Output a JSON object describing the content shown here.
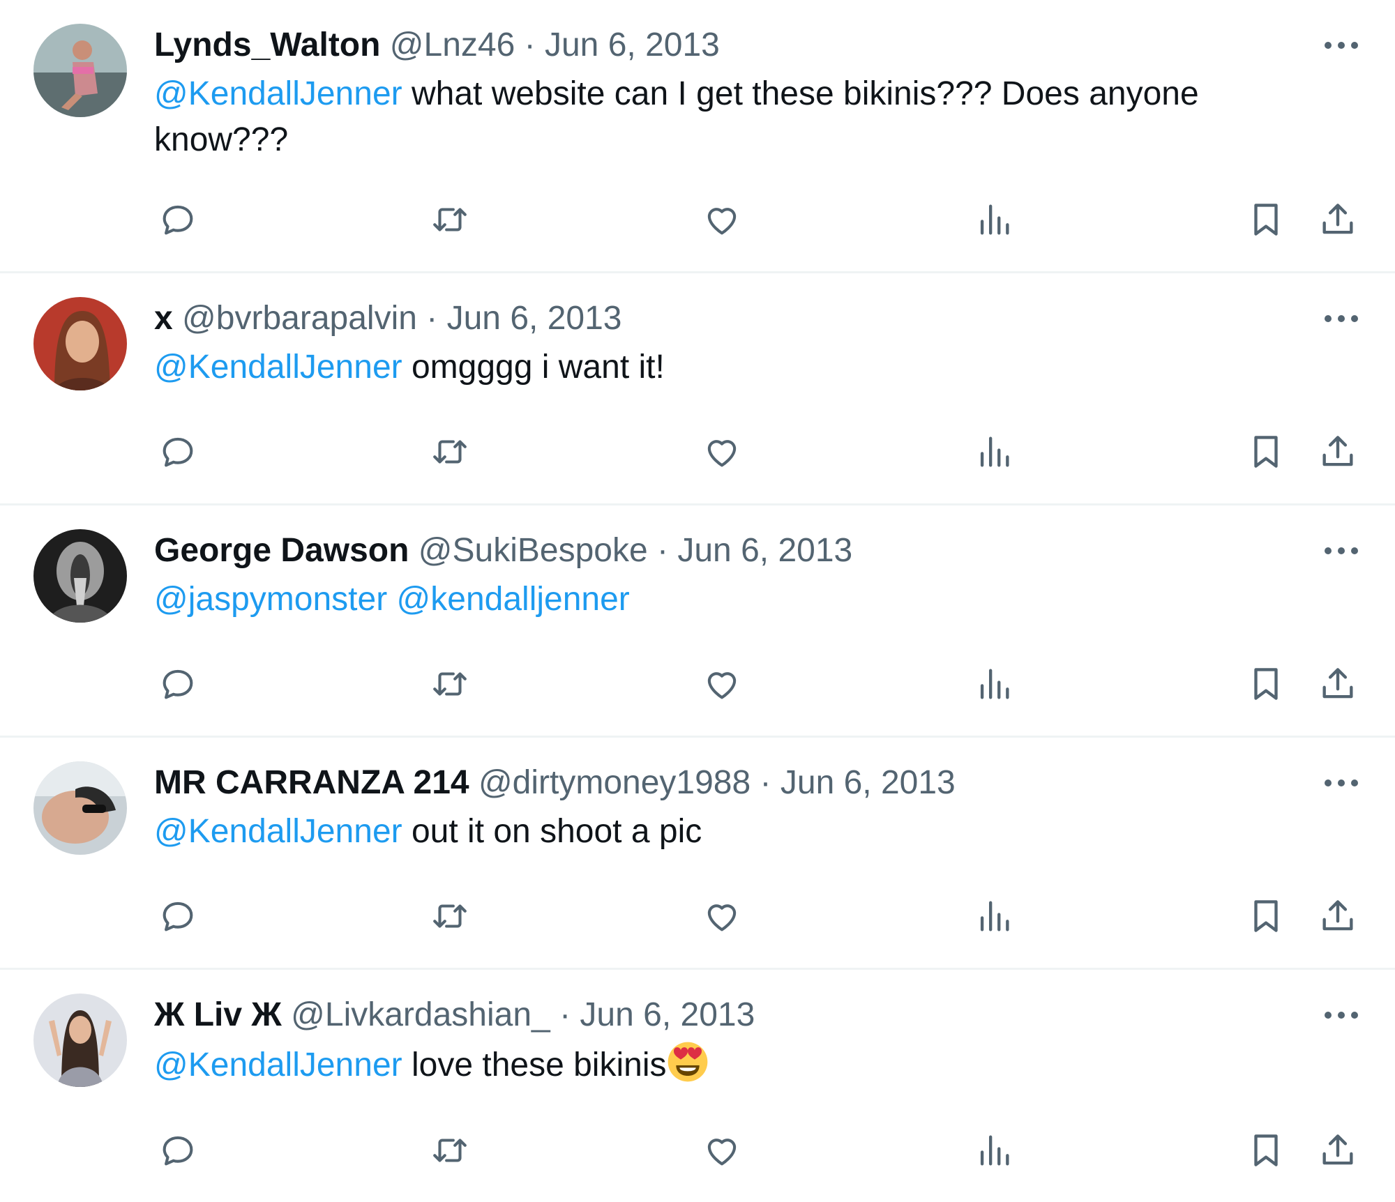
{
  "tweets": [
    {
      "name": "Lynds_Walton",
      "handle": "@Lnz46",
      "separator": "·",
      "date": "Jun 6, 2013",
      "mentions": [
        "@KendallJenner"
      ],
      "text": " what website can I get these bikinis??? Does anyone know???",
      "emoji": "",
      "avatar": {
        "bg": "#9fb3b5",
        "fg": "#d9a0b0"
      }
    },
    {
      "name": "x",
      "handle": "@bvrbarapalvin",
      "separator": "·",
      "date": "Jun 6, 2013",
      "mentions": [
        "@KendallJenner"
      ],
      "text": " omgggg i want it!",
      "emoji": "",
      "avatar": {
        "bg": "#b83a2c",
        "fg": "#e2b08e"
      }
    },
    {
      "name": "George Dawson",
      "handle": "@SukiBespoke",
      "separator": "·",
      "date": "Jun 6, 2013",
      "mentions": [
        "@jaspymonster",
        "@kendalljenner"
      ],
      "text": "",
      "emoji": "",
      "avatar": {
        "bg": "#1e1e1e",
        "fg": "#bdbdbd"
      }
    },
    {
      "name": "MR CARRANZA 214",
      "handle": "@dirtymoney1988",
      "separator": "·",
      "date": "Jun 6, 2013",
      "mentions": [
        "@KendallJenner"
      ],
      "text": " out it on shoot a pic",
      "emoji": "",
      "avatar": {
        "bg": "#c9d1d6",
        "fg": "#d7a990"
      }
    },
    {
      "name": "Ж Liv Ж",
      "handle": "@Livkardashian_",
      "separator": "·",
      "date": "Jun 6, 2013",
      "mentions": [
        "@KendallJenner"
      ],
      "text": " love these bikinis",
      "emoji": "smiling-face-with-heart-eyes",
      "avatar": {
        "bg": "#dfe2e8",
        "fg": "#3a2a22"
      }
    }
  ],
  "colors": {
    "mention": "#1d9bf0",
    "secondary_text": "#536471",
    "icon": "#536471",
    "divider": "#eff3f4"
  },
  "action_icons": [
    "reply-icon",
    "retweet-icon",
    "like-icon",
    "views-icon",
    "bookmark-icon",
    "share-icon"
  ]
}
